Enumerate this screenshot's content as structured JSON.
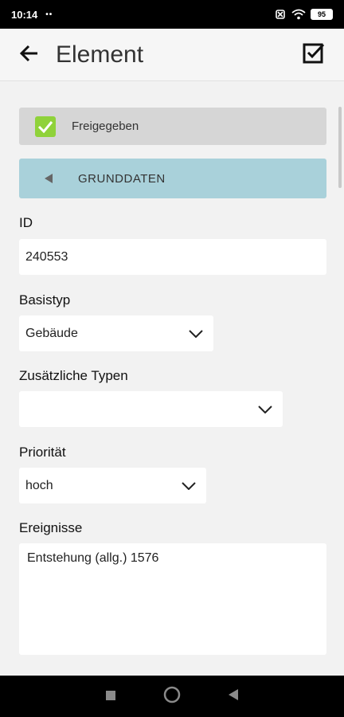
{
  "status_bar": {
    "time": "10:14",
    "notification_dots": "••",
    "battery_level": "95"
  },
  "app_bar": {
    "title": "Element",
    "back_icon": "arrow-left-icon",
    "confirm_icon": "checkbox-checked-icon"
  },
  "released": {
    "label": "Freigegeben",
    "checked": true,
    "color": "#8fd23a"
  },
  "section": {
    "label": "GRUNDDATEN",
    "color": "#a9d1da"
  },
  "fields": {
    "id": {
      "label": "ID",
      "value": "240553"
    },
    "basistyp": {
      "label": "Basistyp",
      "value": "Gebäude"
    },
    "zusaetzliche_typen": {
      "label": "Zusätzliche Typen",
      "value": ""
    },
    "prioritaet": {
      "label": "Priorität",
      "value": "hoch"
    },
    "ereignisse": {
      "label": "Ereignisse",
      "value": "Entstehung (allg.) 1576"
    }
  },
  "nav": {
    "recent_icon": "square-icon",
    "home_icon": "circle-icon",
    "back_icon": "triangle-back-icon"
  }
}
